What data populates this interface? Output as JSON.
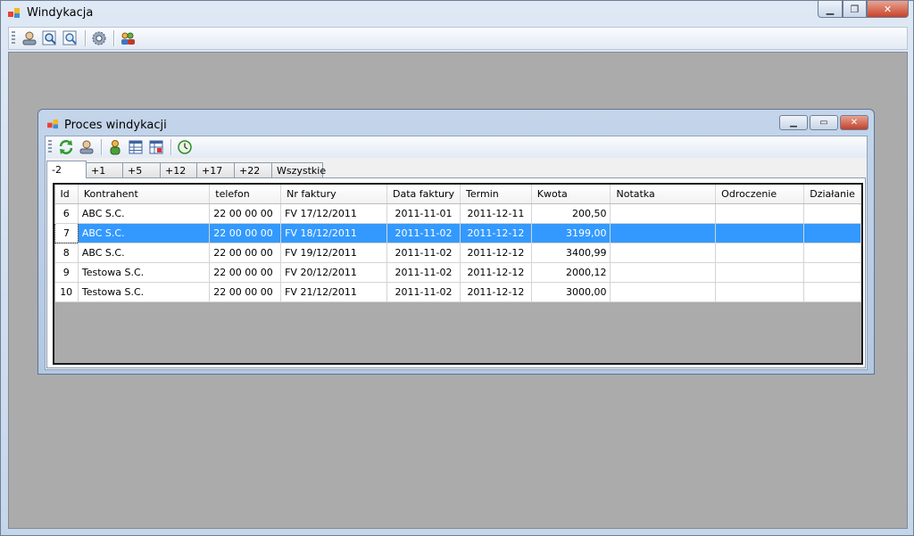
{
  "window": {
    "title": "Windykacja"
  },
  "child": {
    "title": "Proces windykacji",
    "tabs": [
      "-2",
      "+1",
      "+5",
      "+12",
      "+17",
      "+22",
      "Wszystkie"
    ],
    "grid": {
      "columns": [
        "Id",
        "Kontrahent",
        "telefon",
        "Nr faktury",
        "Data faktury",
        "Termin",
        "Kwota",
        "Notatka",
        "Odroczenie",
        "Działanie"
      ],
      "rows": [
        [
          "6",
          "ABC S.C.",
          "22 00 00 00",
          "FV 17/12/2011",
          "2011-11-01",
          "2011-12-11",
          "200,50",
          "",
          "",
          ""
        ],
        [
          "7",
          "ABC S.C.",
          "22 00 00 00",
          "FV 18/12/2011",
          "2011-11-02",
          "2011-12-12",
          "3199,00",
          "",
          "",
          ""
        ],
        [
          "8",
          "ABC S.C.",
          "22 00 00 00",
          "FV 19/12/2011",
          "2011-11-02",
          "2011-12-12",
          "3400,99",
          "",
          "",
          ""
        ],
        [
          "9",
          "Testowa S.C.",
          "22 00 00 00",
          "FV 20/12/2011",
          "2011-11-02",
          "2011-12-12",
          "2000,12",
          "",
          "",
          ""
        ],
        [
          "10",
          "Testowa S.C.",
          "22 00 00 00",
          "FV 21/12/2011",
          "2011-11-02",
          "2011-12-12",
          "3000,00",
          "",
          "",
          ""
        ]
      ],
      "selected_row": 1
    }
  },
  "colors": {
    "selection": "#3399ff",
    "mdi_background": "#ababab"
  }
}
